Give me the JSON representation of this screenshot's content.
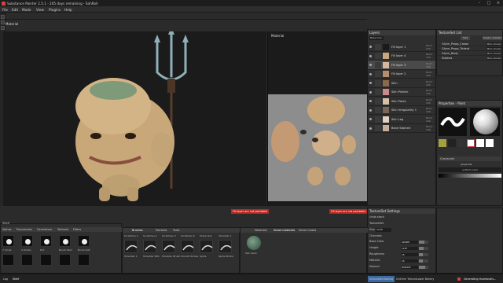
{
  "window": {
    "title": "Substance Painter 2.5.1 - 205 days remaining - SahRoh"
  },
  "menu": [
    "File",
    "Edit",
    "Mode",
    "View",
    "Plugins",
    "Help"
  ],
  "viewport": {
    "left_label": "Material",
    "right_label": "Material",
    "left_error": "Fill layer are not paintable",
    "right_error": "Fill layer are not paintable"
  },
  "layers": {
    "title": "Layers",
    "channel": "Base Colo",
    "rows": [
      {
        "name": "Fill layer 1",
        "blend": "Norm",
        "blend_val": "100",
        "thumb": "#1a1a1a",
        "selected": false
      },
      {
        "name": "Fill layer 4",
        "blend": "Norm",
        "blend_val": "100",
        "thumb": "#c9a77e",
        "selected": false
      },
      {
        "name": "Fill layer 3",
        "blend": "Norm",
        "blend_val": "100",
        "thumb": "#d8b89a",
        "selected": true
      },
      {
        "name": "Fill layer 2",
        "blend": "Norm",
        "blend_val": "100",
        "thumb": "#b88c6c",
        "selected": false
      },
      {
        "name": "Skin",
        "blend": "Norm",
        "blend_val": "100",
        "thumb": "#8a6a4f",
        "selected": false
      },
      {
        "name": "Skin Pinkish",
        "blend": "Norm",
        "blend_val": "100",
        "thumb": "#c88a8a",
        "selected": false
      },
      {
        "name": "Skin Pores",
        "blend": "Norm",
        "blend_val": "100",
        "thumb": "#d6c2a8",
        "selected": false
      },
      {
        "name": "Skin Irregularity 1",
        "blend": "Norm",
        "blend_val": "100",
        "thumb": "#7a6656",
        "selected": false
      },
      {
        "name": "Skin Leg",
        "blend": "Norm",
        "blend_val": "100",
        "thumb": "#e0d2c0",
        "selected": false
      },
      {
        "name": "Bone Stained",
        "blend": "Norm",
        "blend_val": "100",
        "thumb": "#c4b098",
        "selected": false
      }
    ]
  },
  "texture_sets": {
    "title": "TextureSet List",
    "settings_btn": "Sets",
    "shaders_btn": "Shader shaders",
    "rows": [
      {
        "name": "Glynn_Props_Crown",
        "shader": "Main shader"
      },
      {
        "name": "Glynn_Props_Trident",
        "shader": "Main shader"
      },
      {
        "name": "Glynn_Body",
        "shader": "Main shader"
      },
      {
        "name": "Slashes",
        "shader": "Main shader"
      }
    ]
  },
  "properties": {
    "title": "Properties - Paint",
    "grayscale_label": "Grayscale",
    "grayscale_sub": "grayscale",
    "grayscale_sub2": "uniform color"
  },
  "texset_settings": {
    "title": "TextureSet Settings",
    "undo_stack": "Undo stack",
    "section": "TextureSet",
    "size_label": "Size",
    "size_value": "2048",
    "channels_label": "Channels",
    "channels": [
      {
        "name": "Base Color",
        "value": "sRGB8",
        "fill": 0.6
      },
      {
        "name": "Height",
        "value": "L16F",
        "fill": 0.5
      },
      {
        "name": "Roughness",
        "value": "L8",
        "fill": 0.45
      },
      {
        "name": "Metallic",
        "value": "L8",
        "fill": 0.45
      },
      {
        "name": "Normal",
        "value": "RGB16F",
        "fill": 0.7
      }
    ]
  },
  "shelf": {
    "title": "Shelf",
    "tabs": [
      "Alphas",
      "Procedurals",
      "Generators",
      "Textures",
      "Filters"
    ],
    "alphas": [
      "7 Circle",
      "4 Vortex",
      "Dot",
      "Brush Hard",
      "Brush Soft"
    ],
    "brush_tabs": [
      "Brushes",
      "Particles",
      "Tools"
    ],
    "brushes_top": [
      "Scratches 1",
      "Scratches 2",
      "Scratches 3",
      "Scratches 4",
      "Sharp One",
      "Shredder 1"
    ],
    "brushes_bottom": [
      "Shredder 1",
      "Shredder Wiki",
      "Shoulder Brush",
      "Smooth Stroke",
      "Spots",
      "Spots Stroke"
    ],
    "mat_tabs": [
      "Materials",
      "Smart materials",
      "Smart masks"
    ],
    "mat_item": "Skin Alien"
  },
  "status": {
    "left_tabs": [
      "Log",
      "Shelf"
    ],
    "right": [
      "Unbundled baking",
      "Uniform Texture",
      "Lower Bakery"
    ],
    "generating": "Generating thumbnails..."
  },
  "colors": {
    "accent": "#3c6aa3",
    "error": "#b7261f",
    "panel": "#2f2f2f"
  }
}
